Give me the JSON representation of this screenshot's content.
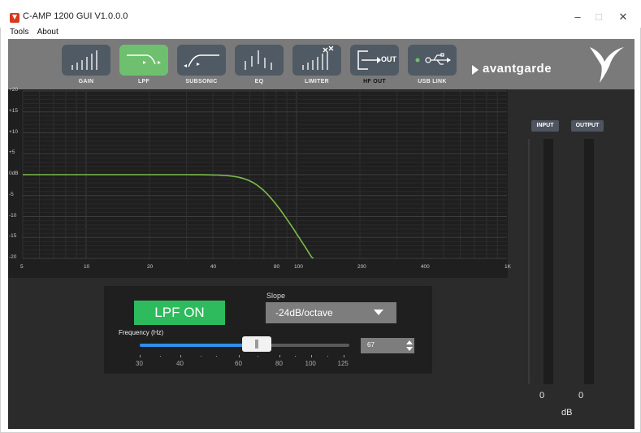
{
  "window": {
    "title": "C-AMP 1200  GUI V1.0.0.0",
    "minimize": "–",
    "maximize": "□",
    "close": "✕"
  },
  "menu": [
    "Tools",
    "About"
  ],
  "toolbar": {
    "buttons": [
      {
        "label": "GAIN",
        "icon": "gain-bars-icon"
      },
      {
        "label": "LPF",
        "icon": "lowpass-curve-icon",
        "active": true
      },
      {
        "label": "SUBSONIC",
        "icon": "highpass-curve-icon"
      },
      {
        "label": "EQ",
        "icon": "eq-sliders-icon"
      },
      {
        "label": "LIMITER",
        "icon": "limiter-bars-icon"
      },
      {
        "label": "HF OUT",
        "icon": "output-arrow-icon",
        "text": "OUT"
      },
      {
        "label": "USB LINK",
        "icon": "usb-icon"
      }
    ],
    "brand": "avantgarde",
    "active_color": "#6ec06e"
  },
  "graph": {
    "y_ticks": [
      "+20",
      "+15",
      "+10",
      "+5",
      "0dB",
      "-5",
      "-10",
      "-15",
      "-20"
    ],
    "x_ticks": [
      "5",
      "10",
      "20",
      "40",
      "80",
      "100",
      "200",
      "400",
      "1K"
    ],
    "curve_color": "#7dba4a"
  },
  "lpf": {
    "toggle_label": "LPF ON",
    "slope_label": "Slope",
    "slope_value": "-24dB/octave",
    "frequency_label": "Frequency (Hz)",
    "frequency_value": "67",
    "slider_ticks": [
      "30",
      "40",
      "60",
      "80",
      "100",
      "125"
    ],
    "slider_fraction": 0.56
  },
  "meters": {
    "input_label": "INPUT",
    "output_label": "OUTPUT",
    "input_value": "0",
    "output_value": "0",
    "unit": "dB"
  }
}
